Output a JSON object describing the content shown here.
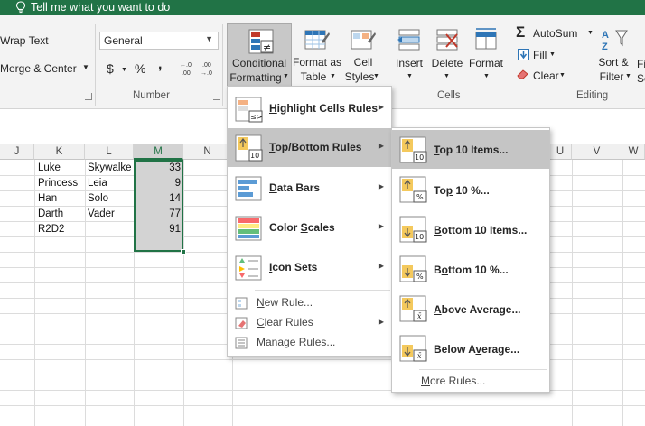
{
  "tellbar": {
    "text": "Tell me what you want to do"
  },
  "ribbon": {
    "alignment": {
      "wrap_text": "Wrap Text",
      "merge_center": "Merge & Center"
    },
    "number": {
      "format_value": "General",
      "currency": "$",
      "percent": "%",
      "comma": ",",
      "inc_dec": "←.0\n.00",
      "dec_dec": ".00\n→.0",
      "group_label": "Number"
    },
    "styles": {
      "conditional_l1": "Conditional",
      "conditional_l2": "Formatting",
      "format_table_l1": "Format as",
      "format_table_l2": "Table",
      "cell_styles_l1": "Cell",
      "cell_styles_l2": "Styles"
    },
    "cells": {
      "insert": "Insert",
      "delete": "Delete",
      "format": "Format",
      "group_label": "Cells"
    },
    "editing": {
      "autosum": "AutoSum",
      "fill": "Fill",
      "clear": "Clear",
      "sort_l1": "Sort &",
      "sort_l2": "Filter",
      "find_l1": "Fi",
      "find_l2": "Se",
      "group_label": "Editing"
    }
  },
  "sheet": {
    "columns": [
      "J",
      "K",
      "L",
      "M",
      "N",
      "U",
      "V",
      "W"
    ],
    "rows": [
      {
        "first": "Luke",
        "last": "Skywalke",
        "value": "33"
      },
      {
        "first": "Princess",
        "last": "Leia",
        "value": "9"
      },
      {
        "first": "Han",
        "last": "Solo",
        "value": "14"
      },
      {
        "first": "Darth",
        "last": "Vader",
        "value": "77"
      },
      {
        "first": "R2D2",
        "last": "",
        "value": "91"
      }
    ]
  },
  "cf_menu": {
    "items": [
      {
        "label": "Highlight Cells Rules",
        "accel": "H"
      },
      {
        "label": "Top/Bottom Rules",
        "accel": "T"
      },
      {
        "label": "Data Bars",
        "accel": "D"
      },
      {
        "label": "Color Scales",
        "accel": "S"
      },
      {
        "label": "Icon Sets",
        "accel": "I"
      }
    ],
    "commands": [
      {
        "label": "New Rule...",
        "accel": "N"
      },
      {
        "label": "Clear Rules",
        "accel": "C"
      },
      {
        "label": "Manage Rules...",
        "accel": "R"
      }
    ]
  },
  "tb_menu": {
    "items": [
      {
        "label": "Top 10 Items...",
        "accel": "T"
      },
      {
        "label": "Top 10 %...",
        "accel": "P"
      },
      {
        "label": "Bottom 10 Items...",
        "accel": "B"
      },
      {
        "label": "Bottom 10 %...",
        "accel": "O"
      },
      {
        "label": "Above Average...",
        "accel": "A"
      },
      {
        "label": "Below Average...",
        "accel": "V"
      }
    ],
    "more": "More Rules..."
  },
  "icons": {
    "tellbar": "lightbulb-icon",
    "menu_items": [
      "highlight-rules-icon",
      "top-bottom-icon",
      "data-bars-icon",
      "color-scales-icon",
      "icon-sets-icon"
    ]
  },
  "colors": {
    "accent": "#217346",
    "highlight": "#c5c5c5",
    "selection": "#d3d3d3"
  }
}
